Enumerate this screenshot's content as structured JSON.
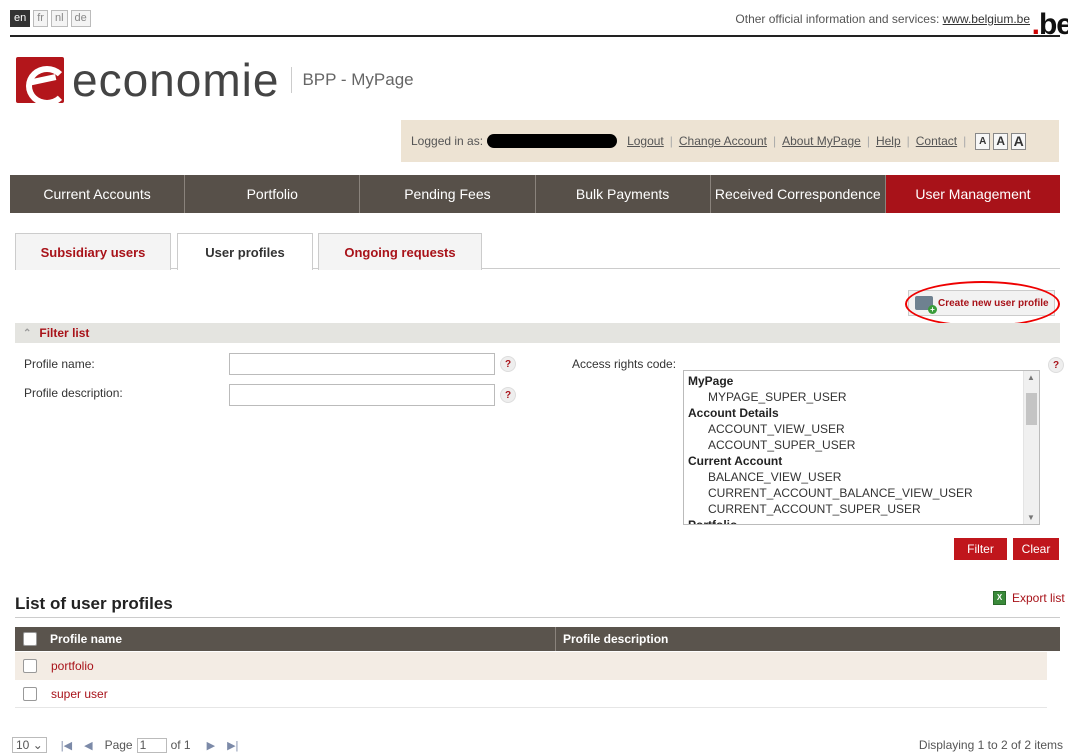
{
  "languages": [
    "en",
    "fr",
    "nl",
    "de"
  ],
  "active_language": "en",
  "topbar": {
    "official_text": "Other official information and services:",
    "official_link": "www.belgium.be",
    "be_logo": ".be"
  },
  "logo": {
    "word": "economie",
    "sub": "BPP - MyPage"
  },
  "login": {
    "logged_in_as": "Logged in as:",
    "links": [
      "Logout",
      "Change Account",
      "About MyPage",
      "Help",
      "Contact"
    ],
    "font_sizes": [
      "A",
      "A",
      "A"
    ]
  },
  "nav": {
    "items": [
      "Current Accounts",
      "Portfolio",
      "Pending Fees",
      "Bulk Payments",
      "Received Correspondence",
      "User Management"
    ],
    "active": "User Management"
  },
  "tabs": {
    "items": [
      "Subsidiary users",
      "User profiles",
      "Ongoing requests"
    ],
    "active": "User profiles"
  },
  "create_button": {
    "label": "Create new user profile",
    "icon": "user-add-icon"
  },
  "filter": {
    "title": "Filter list",
    "profile_name_label": "Profile name:",
    "profile_name_value": "",
    "profile_description_label": "Profile description:",
    "profile_description_value": "",
    "access_rights_label": "Access rights code:",
    "help": "?",
    "access_groups": [
      {
        "name": "MyPage",
        "options": [
          "MYPAGE_SUPER_USER"
        ]
      },
      {
        "name": "Account Details",
        "options": [
          "ACCOUNT_VIEW_USER",
          "ACCOUNT_SUPER_USER"
        ]
      },
      {
        "name": "Current Account",
        "options": [
          "BALANCE_VIEW_USER",
          "CURRENT_ACCOUNT_BALANCE_VIEW_USER",
          "CURRENT_ACCOUNT_SUPER_USER"
        ]
      },
      {
        "name": "Portfolio",
        "options": []
      }
    ],
    "filter_button": "Filter",
    "clear_button": "Clear"
  },
  "list": {
    "title": "List of user profiles",
    "export_label": "Export list",
    "columns": [
      "Profile name",
      "Profile description"
    ],
    "rows": [
      {
        "name": "portfolio",
        "description": ""
      },
      {
        "name": "super user",
        "description": ""
      }
    ]
  },
  "pager": {
    "page_size": "10",
    "page_label": "Page",
    "page_value": "1",
    "of_label": "of 1",
    "displaying": "Displaying 1 to 2 of 2 items"
  },
  "colors": {
    "brand_red": "#a81219",
    "nav_bg": "#575049",
    "active_nav": "#a81219",
    "login_bg": "#ede3d3"
  }
}
